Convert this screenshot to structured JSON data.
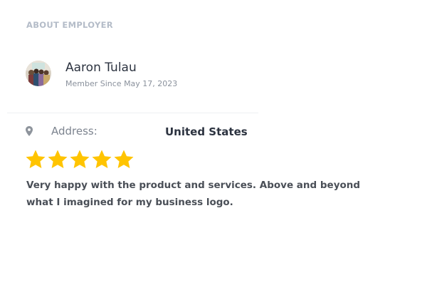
{
  "section": {
    "title": "ABOUT EMPLOYER"
  },
  "employer": {
    "name": "Aaron Tulau",
    "member_since": "Member Since May 17, 2023",
    "avatar_icon": "avatar-photo"
  },
  "address": {
    "icon": "map-pin-icon",
    "label": "Address:",
    "value": "United States"
  },
  "review": {
    "rating": 5,
    "max_rating": 5,
    "star_color": "#ffc400",
    "text": "Very happy with the product and services. Above and beyond what I imagined for my business logo."
  },
  "colors": {
    "title": "#b4bcc8",
    "name": "#2c3340",
    "muted": "#8a919c",
    "review_text": "#4a4f57"
  }
}
